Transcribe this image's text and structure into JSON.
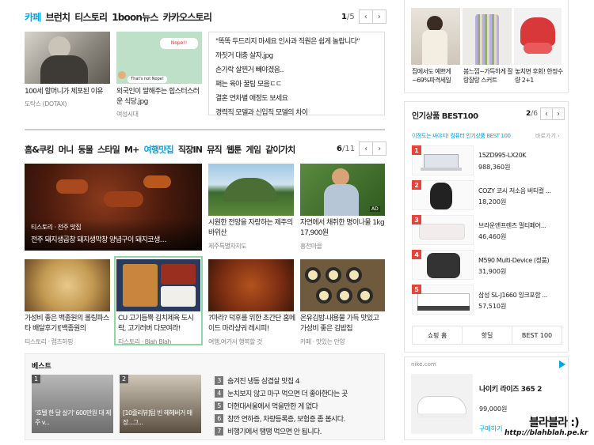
{
  "cafe_section": {
    "tabs": [
      "카페",
      "브런치",
      "티스토리",
      "1boon뉴스",
      "카카오스토리"
    ],
    "page_current": "1",
    "page_total": "/5",
    "cards": [
      {
        "title": "100세 할머니가 체포된 이유",
        "source": "도탁스 (DOTAX)"
      },
      {
        "title": "외국인이 말해주는 힙스터스러운 식당.jpg",
        "source": "여성시대",
        "bubble_top": "Nope!!",
        "bubble_bottom": "That's not Nope!"
      }
    ],
    "list": [
      "\"똑똑 두드리지 마세요 인사과 직원은 쉽게 놀랍니다\"",
      "까짓거 대충 살자.jpg",
      "손가락 살찐거 빼야겠음..",
      "쩌는 육아 꿀팁 모음ㄷㄷ",
      "결혼 연차별 애정도 보세요",
      "경력직 모델과 신입직 모델의 차이"
    ]
  },
  "food_section": {
    "tabs": [
      "홈&쿠킹",
      "머니",
      "동물",
      "스타일",
      "M+",
      "여행맛집",
      "직장IN",
      "뮤직",
      "웹툰",
      "게임",
      "같이가치"
    ],
    "page_current": "6",
    "page_total": "/11",
    "main_card": {
      "category": "티스토리 · 전주 맛집",
      "title": "전주 돼지생곱창 돼지생막창 양념구이 돼지코생…"
    },
    "cards": [
      {
        "title": "시원한 전망을 자랑하는 제주의 바위산",
        "source": "제주특별자치도"
      },
      {
        "title": "자연에서 채취한 명이나물 1kg 17,900원",
        "source": "홍천마을",
        "badge": "AD"
      },
      {
        "title": "가성비 좋은 백종원의 롤링파스타 배달후기![백종원의",
        "source": "티스토리 · 랩츠하핑"
      },
      {
        "title": "CU 고기듬뿍 김치제육 도시락, 고기러버 다모여라!",
        "source": "티스토리 · Blah Blah"
      },
      {
        "title": "?마라? 덕후를 위한 초간단 홈메이드 마라샹궈 레시피!",
        "source": "여행,여가서 행복할 것"
      },
      {
        "title": "온유김밥-내용물 가득 맛있고 가성비 좋은 김밥집",
        "source": "카페 · 맛있는 안양"
      }
    ]
  },
  "best_section": {
    "label": "베스트",
    "cards": [
      {
        "rank": "1",
        "title": "'호텔 한 달 살기' 600만원 대 제주 v..."
      },
      {
        "rank": "2",
        "title": "[10줄리뷰]텀 빈 헤헤버거 매장...그..."
      }
    ],
    "list": [
      {
        "rank": "3",
        "text": "숨겨진 냉동 삼겹살 맛집 4"
      },
      {
        "rank": "4",
        "text": "눈치보지 않고 마구 먹으면 더 좋아한다는 곳"
      },
      {
        "rank": "5",
        "text": "더현대서울에서 먹을만한 게 없다"
      },
      {
        "rank": "6",
        "text": "참깐 연하증, 차량등록증, 보험증 좀 봅시다."
      },
      {
        "rank": "7",
        "text": "비행기에서 땡땡 먹으면 안 됩니다."
      }
    ]
  },
  "shopping_top": {
    "items": [
      {
        "title": "집에서도 예쁘게 ~69%파격세일"
      },
      {
        "title": "봄느낌~가득하게 잘랑잘랑 스커트"
      },
      {
        "title": "놓치면 후회! 한정수량 2+1"
      }
    ]
  },
  "best100": {
    "title": "인기상품 BEST100",
    "page_current": "2",
    "page_total": "/6",
    "subtitle": "이정도는 싸야지! 컴퓨터 인기상품 BEST 100",
    "more": "바로가기 ›",
    "items": [
      {
        "rank": "1",
        "name": "15ZD995-LX20K",
        "price": "988,360원"
      },
      {
        "rank": "2",
        "name": "COZY 코시 저소음 버티컬 ...",
        "price": "18,200원"
      },
      {
        "rank": "3",
        "name": "브라운앤프렌즈 멀티페어...",
        "price": "46,460원"
      },
      {
        "rank": "4",
        "name": "M590 Multi-Device (정품)",
        "price": "31,900원"
      },
      {
        "rank": "5",
        "name": "삼성 SL-J1660 잉크포함 ...",
        "price": "57,510원"
      }
    ],
    "tabs": [
      "쇼핑 홈",
      "핫딜",
      "BEST 100"
    ]
  },
  "ad": {
    "domain": "nike.com",
    "product": "나이키 라이즈 365 2",
    "price": "99,000원",
    "cta": "구매하기"
  },
  "watermark": {
    "line1": "블라블라 :)",
    "line2": "http://blahblah.pe.kr"
  },
  "colors": {
    "accent": "#00a4e4",
    "rank_red": "#e8433a",
    "card_border": "#8fd6a8"
  }
}
